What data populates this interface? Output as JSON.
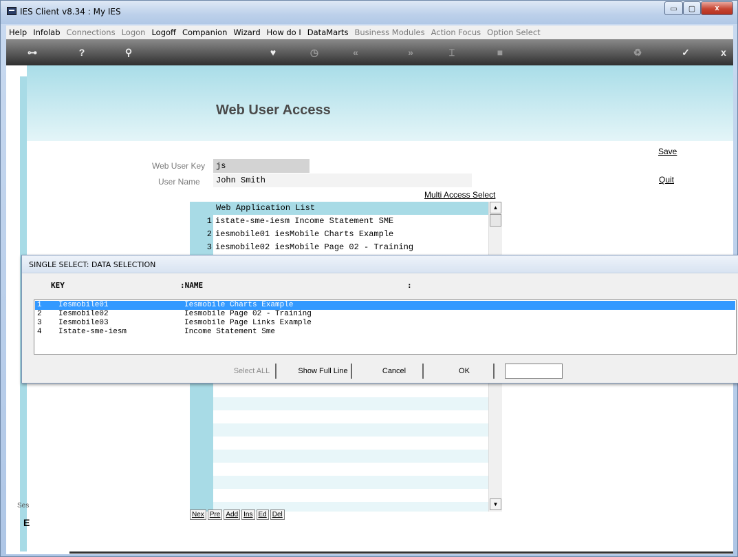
{
  "window": {
    "title": "IES Client v8.34 : My IES",
    "controls": {
      "minimize": "▭",
      "maximize": "▢",
      "close": "x"
    }
  },
  "menu": [
    {
      "label": "Help",
      "enabled": true
    },
    {
      "label": "Infolab",
      "enabled": true
    },
    {
      "label": "Connections",
      "enabled": false
    },
    {
      "label": "Logon",
      "enabled": false
    },
    {
      "label": "Logoff",
      "enabled": true
    },
    {
      "label": "Companion",
      "enabled": true
    },
    {
      "label": "Wizard",
      "enabled": true
    },
    {
      "label": "How do I",
      "enabled": true
    },
    {
      "label": "DataMarts",
      "enabled": true
    },
    {
      "label": "Business Modules",
      "enabled": false
    },
    {
      "label": "Action Focus",
      "enabled": false
    },
    {
      "label": "Option Select",
      "enabled": false
    }
  ],
  "toolbar": [
    {
      "icon": "key-icon",
      "glyph": "⊶"
    },
    {
      "icon": "help-icon",
      "glyph": "?"
    },
    {
      "icon": "search-icon",
      "glyph": "⚲"
    },
    {
      "icon": "heart-icon",
      "glyph": "♥"
    },
    {
      "icon": "clock-icon",
      "glyph": "◷"
    },
    {
      "icon": "rewind-icon",
      "glyph": "«"
    },
    {
      "icon": "forward-icon",
      "glyph": "»"
    },
    {
      "icon": "tools-icon",
      "glyph": "⌶"
    },
    {
      "icon": "stop-icon",
      "glyph": "■"
    },
    {
      "icon": "recycle-icon",
      "glyph": "♻"
    },
    {
      "icon": "check-icon",
      "glyph": "✓"
    },
    {
      "icon": "exit-icon",
      "glyph": "x"
    }
  ],
  "page": {
    "title": "Web User Access",
    "save_link": "Save",
    "quit_link": "Quit",
    "web_user_key_label": "Web User Key",
    "web_user_key_value": "js",
    "user_name_label": "User Name",
    "user_name_value": "John Smith",
    "multi_access_link": "Multi Access Select"
  },
  "app_list": {
    "header": "Web Application List",
    "rows": [
      {
        "num": "1",
        "text": "istate-sme-iesm Income Statement SME"
      },
      {
        "num": "2",
        "text": "iesmobile01 iesMobile Charts Example"
      },
      {
        "num": "3",
        "text": "iesmobile02 iesMobile Page 02 - Training"
      }
    ],
    "nav_buttons": [
      "Nex",
      "Pre",
      "Add",
      "Ins",
      "Ed",
      "Del"
    ],
    "scroll_up": "▲",
    "scroll_down": "▼"
  },
  "side": {
    "ses_label": "Ses",
    "ses_icon": "E"
  },
  "dialog": {
    "title": "SINGLE SELECT: DATA SELECTION",
    "col_key": "KEY",
    "col_name": ":NAME",
    "col_extra": ":",
    "rows": [
      {
        "num": "1",
        "key": "Iesmobile01",
        "name": "Iesmobile Charts Example",
        "selected": true
      },
      {
        "num": "2",
        "key": "Iesmobile02",
        "name": "Iesmobile Page 02 - Training",
        "selected": false
      },
      {
        "num": "3",
        "key": "Iesmobile03",
        "name": "Iesmobile Page Links Example",
        "selected": false
      },
      {
        "num": "4",
        "key": "Istate-sme-iesm",
        "name": "Income Statement Sme",
        "selected": false
      }
    ],
    "buttons": {
      "select_all": "Select ALL",
      "show_full_line": "Show Full Line",
      "cancel": "Cancel",
      "ok": "OK"
    },
    "input_value": ""
  }
}
